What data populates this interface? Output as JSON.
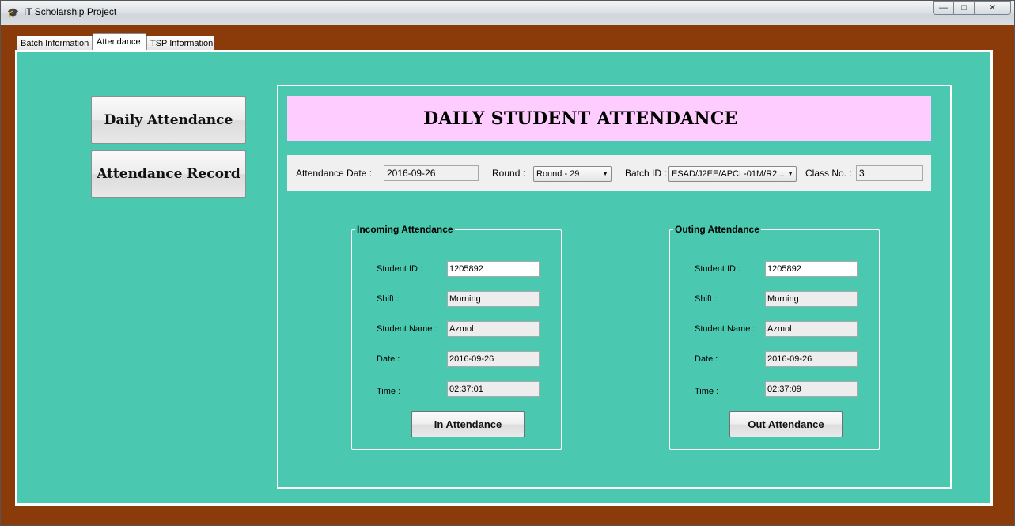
{
  "window": {
    "title": "IT Scholarship Project",
    "icon": "graduation-cap-icon",
    "controls": {
      "minimize": "—",
      "maximize": "□",
      "close": "✕"
    }
  },
  "tabs": [
    {
      "label": "Batch Information",
      "active": false
    },
    {
      "label": "Attendance",
      "active": true
    },
    {
      "label": "TSP Information",
      "active": false
    }
  ],
  "sidebar": {
    "daily_attendance": "Daily Attendance",
    "attendance_record": "Attendance Record"
  },
  "main": {
    "heading": "DAILY STUDENT ATTENDANCE",
    "filters": {
      "date_label": "Attendance Date :",
      "date_value": "2016-09-26",
      "round_label": "Round :",
      "round_value": "Round - 29",
      "batch_label": "Batch ID :",
      "batch_value": "ESAD/J2EE/APCL-01M/R2...",
      "class_label": "Class No. :",
      "class_value": "3"
    },
    "incoming": {
      "title": "Incoming Attendance",
      "student_id_label": "Student ID :",
      "student_id": "1205892",
      "shift_label": "Shift :",
      "shift": "Morning",
      "name_label": "Student Name :",
      "name": "Azmol",
      "date_label": "Date :",
      "date": "2016-09-26",
      "time_label": "Time :",
      "time": "02:37:01",
      "button": "In Attendance"
    },
    "outgoing": {
      "title": "Outing Attendance",
      "student_id_label": "Student ID :",
      "student_id": "1205892",
      "shift_label": "Shift :",
      "shift": "Morning",
      "name_label": "Student Name :",
      "name": "Azmol",
      "date_label": "Date :",
      "date": "2016-09-26",
      "time_label": "Time :",
      "time": "02:37:09",
      "button": "Out Attendance"
    }
  },
  "colors": {
    "frame": "#8b3a0a",
    "content": "#4ac9b0",
    "banner": "#ffccff"
  }
}
